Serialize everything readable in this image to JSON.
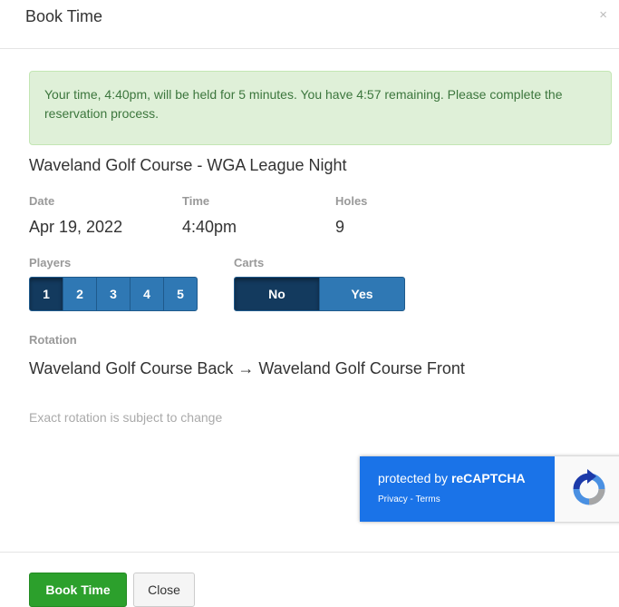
{
  "header": {
    "title": "Book Time",
    "close_icon": "×"
  },
  "alert": {
    "text": "Your time, 4:40pm, will be held for 5 minutes. You have 4:57 remaining. Please complete the reservation process."
  },
  "event": {
    "name": "Waveland Golf Course - WGA League Night"
  },
  "details": {
    "date_label": "Date",
    "date_value": "Apr 19, 2022",
    "time_label": "Time",
    "time_value": "4:40pm",
    "holes_label": "Holes",
    "holes_value": "9"
  },
  "players": {
    "label": "Players",
    "options": [
      "1",
      "2",
      "3",
      "4",
      "5"
    ],
    "selected": "1"
  },
  "carts": {
    "label": "Carts",
    "options": [
      "No",
      "Yes"
    ],
    "selected": "No"
  },
  "rotation": {
    "label": "Rotation",
    "value": "Waveland Golf Course Back → Waveland Golf Course Front",
    "note": "Exact rotation is subject to change"
  },
  "recaptcha": {
    "text_prefix": "protected by ",
    "text_brand": "reCAPTCHA",
    "links": "Privacy - Terms"
  },
  "footer": {
    "book_label": "Book Time",
    "close_label": "Close"
  },
  "colors": {
    "accent": "#2f78b4",
    "active": "#133a5e",
    "success": "#2ca02c",
    "alert_bg": "#dff0d8"
  }
}
